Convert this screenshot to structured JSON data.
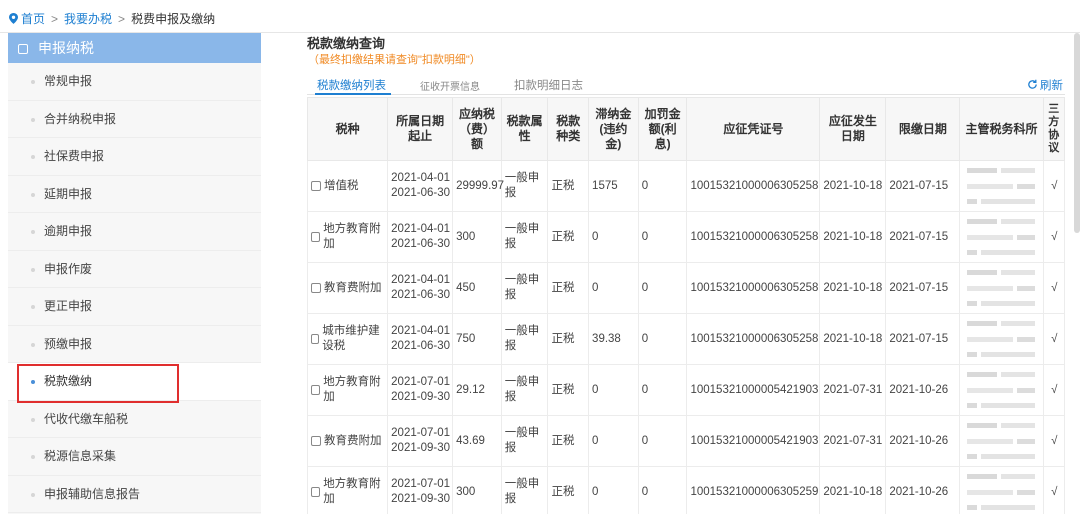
{
  "breadcrumb": {
    "home": "首页",
    "sep1": ">",
    "level2": "我要办税",
    "sep2": ">",
    "current": "税费申报及缴纳"
  },
  "sidebar": {
    "title": "申报纳税",
    "items": [
      {
        "label": "常规申报"
      },
      {
        "label": "合并纳税申报"
      },
      {
        "label": "社保费申报"
      },
      {
        "label": "延期申报"
      },
      {
        "label": "逾期申报"
      },
      {
        "label": "申报作废"
      },
      {
        "label": "更正申报"
      },
      {
        "label": "预缴申报"
      },
      {
        "label": "税款缴纳",
        "active": true
      },
      {
        "label": "代收代缴车船税"
      },
      {
        "label": "税源信息采集"
      },
      {
        "label": "申报辅助信息报告"
      }
    ]
  },
  "main": {
    "title": "税款缴纳查询",
    "hint": "（最终扣缴结果请查询\"扣款明细\"）",
    "tabs": [
      {
        "label": "税款缴纳列表",
        "active": true
      },
      {
        "label": "征收开票信息"
      },
      {
        "label": "扣款明细日志"
      }
    ],
    "refresh": "刷新",
    "columns": {
      "c1": "税种",
      "c2": "所属日期起止",
      "c3": "应纳税（费）额",
      "c4": "税款属性",
      "c5": "税款种类",
      "c6": "滞纳金(违约金)",
      "c7": "加罚金额(利息)",
      "c8": "应征凭证号",
      "c9": "应征发生日期",
      "c10": "限缴日期",
      "c11": "主管税务科所",
      "c12": "三方协议"
    },
    "rows": [
      {
        "tax": "增值税",
        "start": "2021-04-01",
        "end": "2021-06-30",
        "amount": "29999.97",
        "attr": "一般申报",
        "type": "正税",
        "late": "1575",
        "penalty": "0",
        "cert": "10015321000006305258",
        "occur": "2021-10-18",
        "limit": "2021-07-15",
        "agree": "√"
      },
      {
        "tax": "地方教育附加",
        "start": "2021-04-01",
        "end": "2021-06-30",
        "amount": "300",
        "attr": "一般申报",
        "type": "正税",
        "late": "0",
        "penalty": "0",
        "cert": "10015321000006305258",
        "occur": "2021-10-18",
        "limit": "2021-07-15",
        "agree": "√"
      },
      {
        "tax": "教育费附加",
        "start": "2021-04-01",
        "end": "2021-06-30",
        "amount": "450",
        "attr": "一般申报",
        "type": "正税",
        "late": "0",
        "penalty": "0",
        "cert": "10015321000006305258",
        "occur": "2021-10-18",
        "limit": "2021-07-15",
        "agree": "√"
      },
      {
        "tax": "城市维护建设税",
        "start": "2021-04-01",
        "end": "2021-06-30",
        "amount": "750",
        "attr": "一般申报",
        "type": "正税",
        "late": "39.38",
        "penalty": "0",
        "cert": "10015321000006305258",
        "occur": "2021-10-18",
        "limit": "2021-07-15",
        "agree": "√"
      },
      {
        "tax": "地方教育附加",
        "start": "2021-07-01",
        "end": "2021-09-30",
        "amount": "29.12",
        "attr": "一般申报",
        "type": "正税",
        "late": "0",
        "penalty": "0",
        "cert": "10015321000005421903",
        "occur": "2021-07-31",
        "limit": "2021-10-26",
        "agree": "√"
      },
      {
        "tax": "教育费附加",
        "start": "2021-07-01",
        "end": "2021-09-30",
        "amount": "43.69",
        "attr": "一般申报",
        "type": "正税",
        "late": "0",
        "penalty": "0",
        "cert": "10015321000005421903",
        "occur": "2021-07-31",
        "limit": "2021-10-26",
        "agree": "√"
      },
      {
        "tax": "地方教育附加",
        "start": "2021-07-01",
        "end": "2021-09-30",
        "amount": "300",
        "attr": "一般申报",
        "type": "正税",
        "late": "0",
        "penalty": "0",
        "cert": "10015321000006305259",
        "occur": "2021-10-18",
        "limit": "2021-10-26",
        "agree": "√"
      }
    ]
  },
  "colors": {
    "accent": "#1e7fd1",
    "sidebar_header": "#8ab7e9",
    "hint": "#f08a24",
    "highlight": "#e02e2e"
  }
}
